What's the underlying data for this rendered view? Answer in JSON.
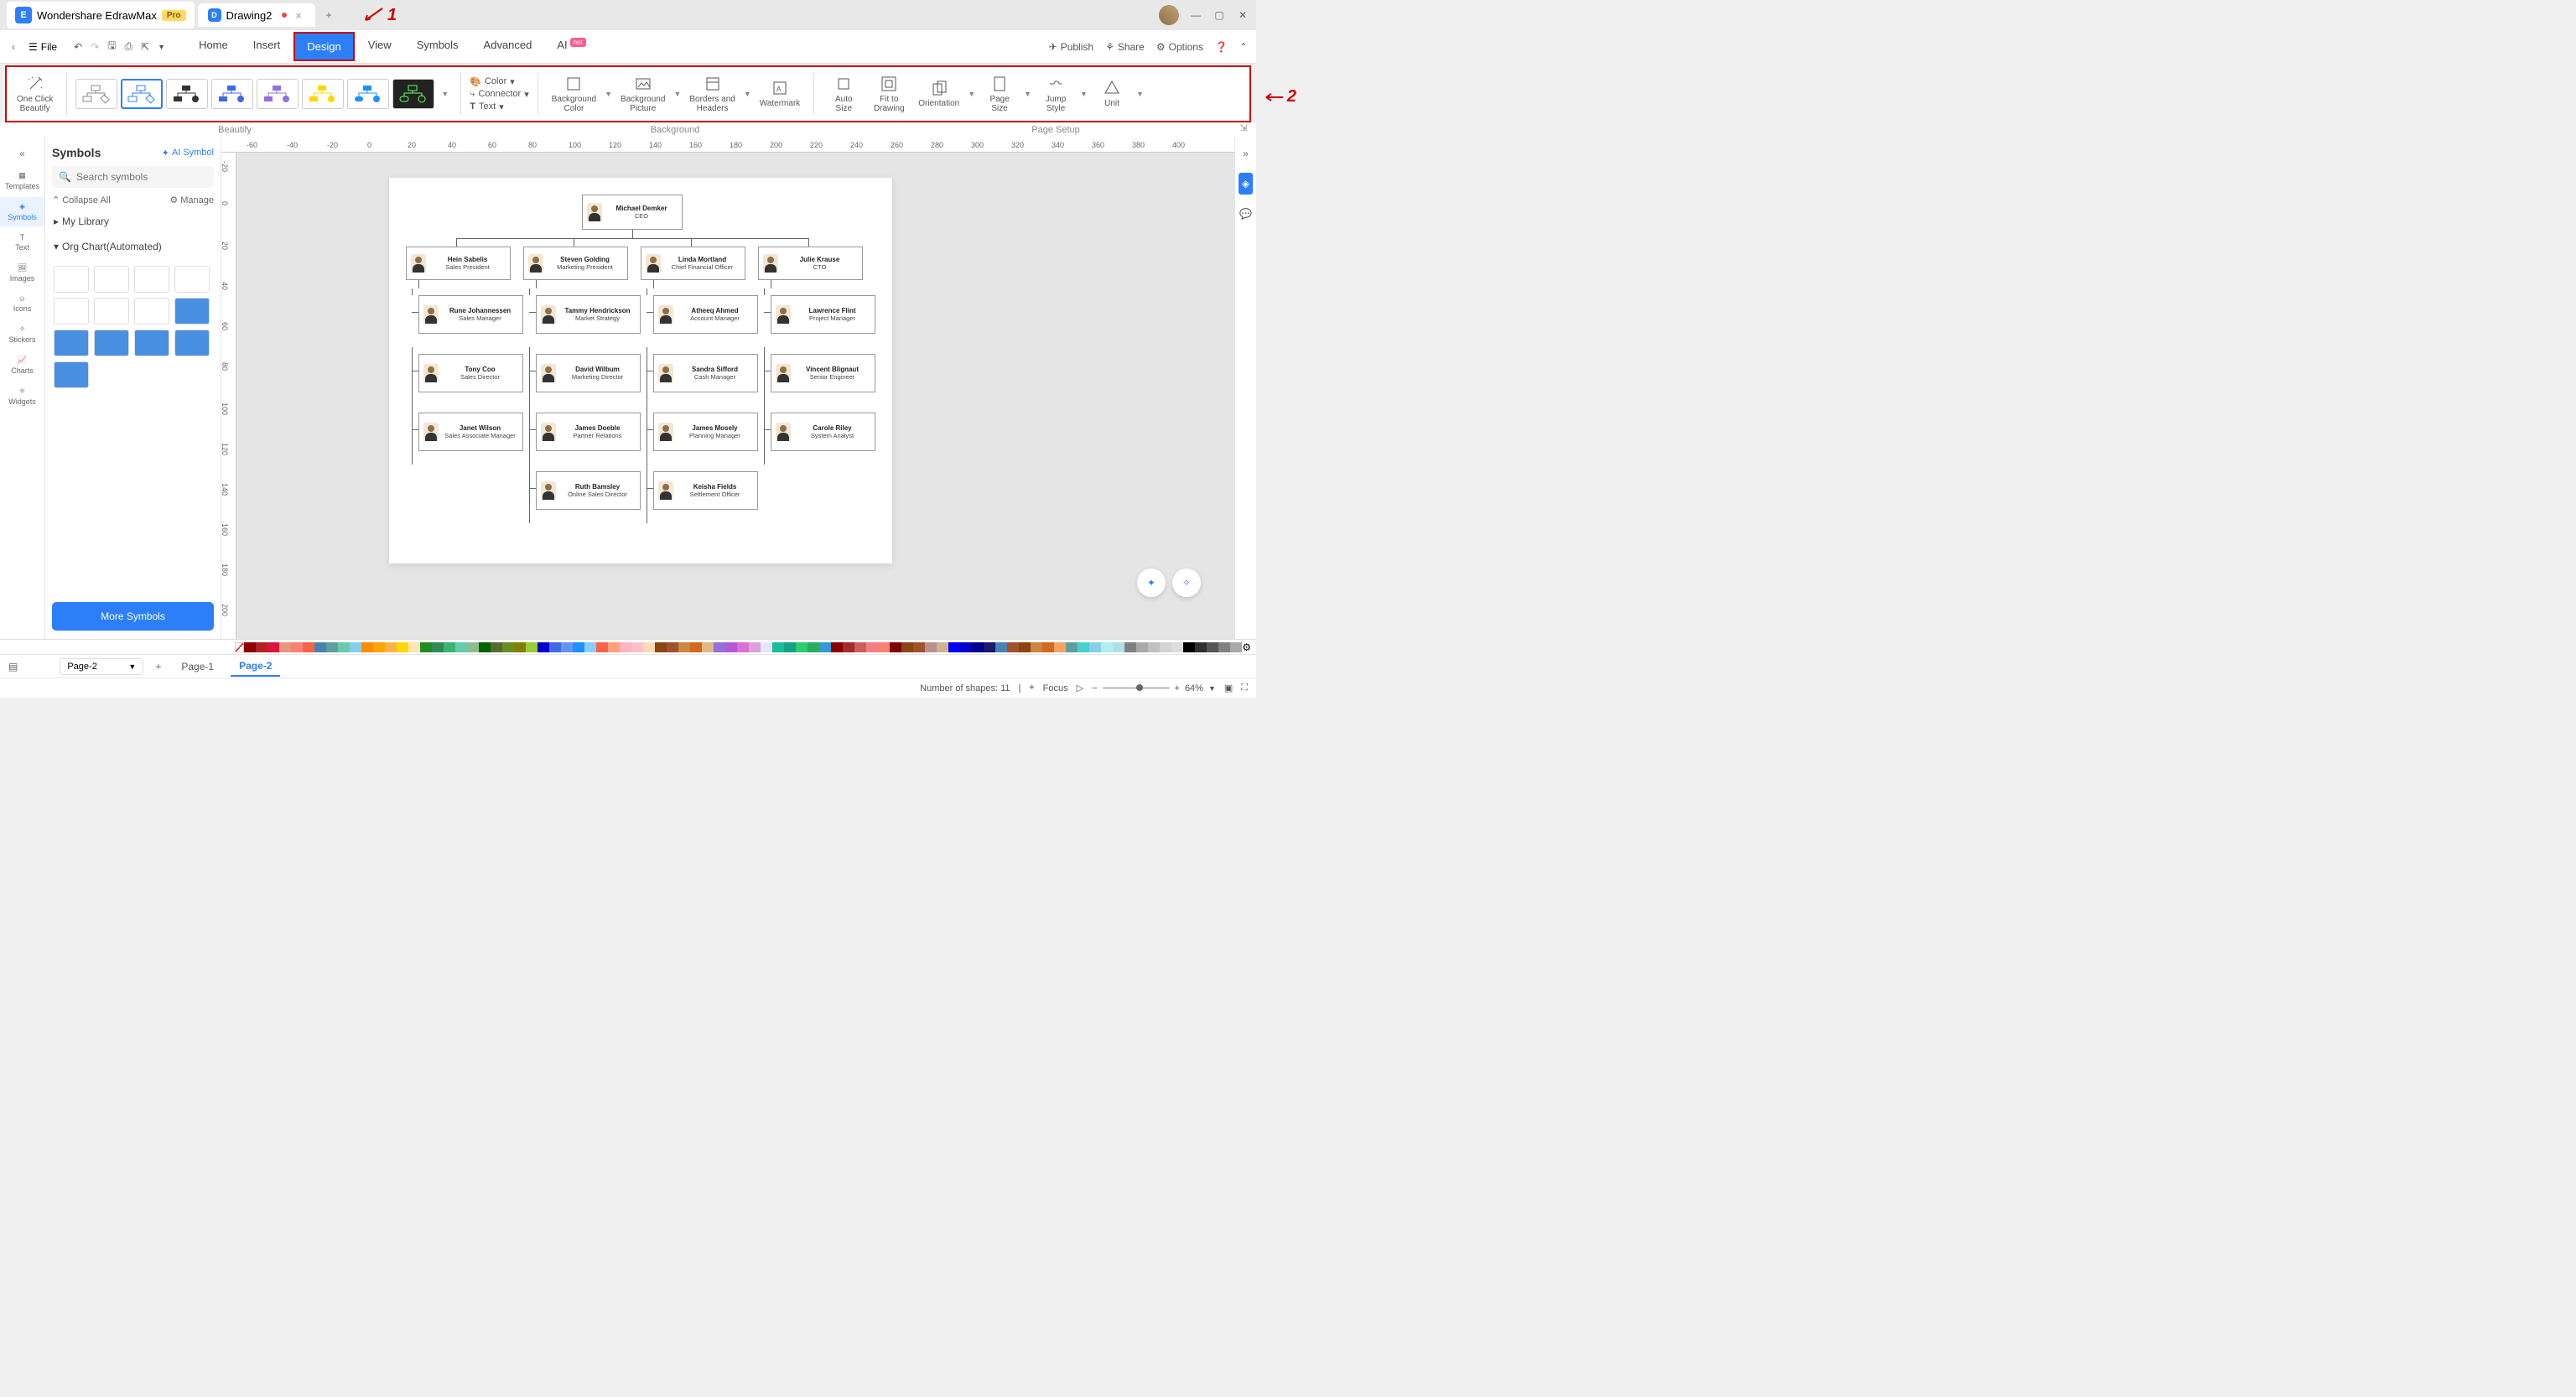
{
  "titlebar": {
    "app_name": "Wondershare EdrawMax",
    "pro_badge": "Pro",
    "doc_name": "Drawing2"
  },
  "menubar": {
    "file": "File",
    "tabs": [
      "Home",
      "Insert",
      "Design",
      "View",
      "Symbols",
      "Advanced",
      "AI"
    ],
    "active_tab": "Design",
    "hot_tag": "hot",
    "publish": "Publish",
    "share": "Share",
    "options": "Options"
  },
  "ribbon": {
    "beautify": {
      "label": "One Click\nBeautify"
    },
    "color": "Color",
    "connector": "Connector",
    "text": "Text",
    "bg_color": "Background\nColor",
    "bg_pic": "Background\nPicture",
    "borders": "Borders and\nHeaders",
    "watermark": "Watermark",
    "auto_size": "Auto\nSize",
    "fit_drawing": "Fit to\nDrawing",
    "orientation": "Orientation",
    "page_size": "Page\nSize",
    "jump_style": "Jump\nStyle",
    "unit": "Unit",
    "groups": [
      "Beautify",
      "Background",
      "Page Setup"
    ]
  },
  "annotations": {
    "a1": "1",
    "a2": "2"
  },
  "left_nav": [
    "Templates",
    "Symbols",
    "Text",
    "Images",
    "Icons",
    "Stickers",
    "Charts",
    "Widgets"
  ],
  "symbols_panel": {
    "title": "Symbols",
    "ai_symbol": "AI Symbol",
    "search_placeholder": "Search symbols",
    "collapse": "Collapse All",
    "manage": "Manage",
    "my_library": "My Library",
    "org_chart": "Org Chart(Automated)",
    "more": "More Symbols"
  },
  "ruler_h": [
    "-60",
    "-40",
    "-20",
    "0",
    "20",
    "40",
    "60",
    "80",
    "100",
    "120",
    "140",
    "160",
    "180",
    "200",
    "220",
    "240",
    "260",
    "280",
    "300",
    "320",
    "340",
    "360",
    "380",
    "400"
  ],
  "ruler_v": [
    "-20",
    "0",
    "20",
    "40",
    "60",
    "80",
    "100",
    "120",
    "140",
    "160",
    "180",
    "200"
  ],
  "org": {
    "ceo": {
      "name": "Michael Demker",
      "role": "CEO"
    },
    "l1": [
      {
        "name": "Hein Sabelis",
        "role": "Sales President"
      },
      {
        "name": "Steven Golding",
        "role": "Marketing President"
      },
      {
        "name": "Linda Mortland",
        "role": "Chief Financial Officer"
      },
      {
        "name": "Julie Krause",
        "role": "CTO"
      }
    ],
    "l2a": [
      {
        "name": "Rune Johannessen",
        "role": "Sales Manager"
      },
      {
        "name": "Tony Coo",
        "role": "Sales Director"
      },
      {
        "name": "Janet Wilson",
        "role": "Sales Associate Manager"
      }
    ],
    "l2b": [
      {
        "name": "Tammy Hendrickson",
        "role": "Market Strategy"
      },
      {
        "name": "David Wilbum",
        "role": "Marketing Director"
      },
      {
        "name": "James Doeble",
        "role": "Partner Relations"
      },
      {
        "name": "Ruth Bamsley",
        "role": "Online Sales Director"
      }
    ],
    "l2c": [
      {
        "name": "Atheeq Ahmed",
        "role": "Account Manager"
      },
      {
        "name": "Sandra Sifford",
        "role": "Cash Manager"
      },
      {
        "name": "James Mosely",
        "role": "Planning Manager"
      },
      {
        "name": "Keisha Fields",
        "role": "Settlement Officer"
      }
    ],
    "l2d": [
      {
        "name": "Lawrence Flint",
        "role": "Project Manager"
      },
      {
        "name": "Vincent Blignaut",
        "role": "Senior Engineer"
      },
      {
        "name": "Carole Riley",
        "role": "System Analyst"
      }
    ]
  },
  "colors": [
    "#8b0000",
    "#b22222",
    "#dc143c",
    "#e9967a",
    "#fa8072",
    "#ff6347",
    "#4682b4",
    "#5f9ea0",
    "#66cdaa",
    "#87ceeb",
    "#ff8c00",
    "#ffa500",
    "#ffb347",
    "#ffd700",
    "#ffe4b5",
    "#228b22",
    "#2e8b57",
    "#3cb371",
    "#66cdaa",
    "#8fbc8f",
    "#006400",
    "#556b2f",
    "#6b8e23",
    "#808000",
    "#9acd32",
    "#0000cd",
    "#4169e1",
    "#6495ed",
    "#1e90ff",
    "#87cefa",
    "#ff6347",
    "#ffa07a",
    "#ffb6c1",
    "#ffc0cb",
    "#ffdab9",
    "#8b4513",
    "#a0522d",
    "#cd853f",
    "#d2691e",
    "#deb887",
    "#9370db",
    "#ba55d3",
    "#da70d6",
    "#dda0dd",
    "#e6e6fa",
    "#1abc9c",
    "#16a085",
    "#2ecc71",
    "#27ae60",
    "#3498db",
    "#8b0000",
    "#a52a2a",
    "#cd5c5c",
    "#f08080",
    "#fa8072",
    "#800000",
    "#8b4513",
    "#a0522d",
    "#bc8f8f",
    "#d2b48c",
    "#0000ff",
    "#0000cd",
    "#00008b",
    "#191970",
    "#4682b4",
    "#a0522d",
    "#8b4513",
    "#cd853f",
    "#d2691e",
    "#f4a460",
    "#5f9ea0",
    "#48d1cc",
    "#87ceeb",
    "#afeeee",
    "#b0e0e6",
    "#808080",
    "#a9a9a9",
    "#c0c0c0",
    "#d3d3d3",
    "#dcdcdc",
    "#000000",
    "#2f2f2f",
    "#555555",
    "#808080",
    "#a9a9a9"
  ],
  "page_tabs": {
    "dropdown": "Page-2",
    "tabs": [
      "Page-1",
      "Page-2"
    ],
    "active": "Page-2"
  },
  "status": {
    "shapes": "Number of shapes: 11",
    "focus": "Focus",
    "zoom": "64%"
  }
}
